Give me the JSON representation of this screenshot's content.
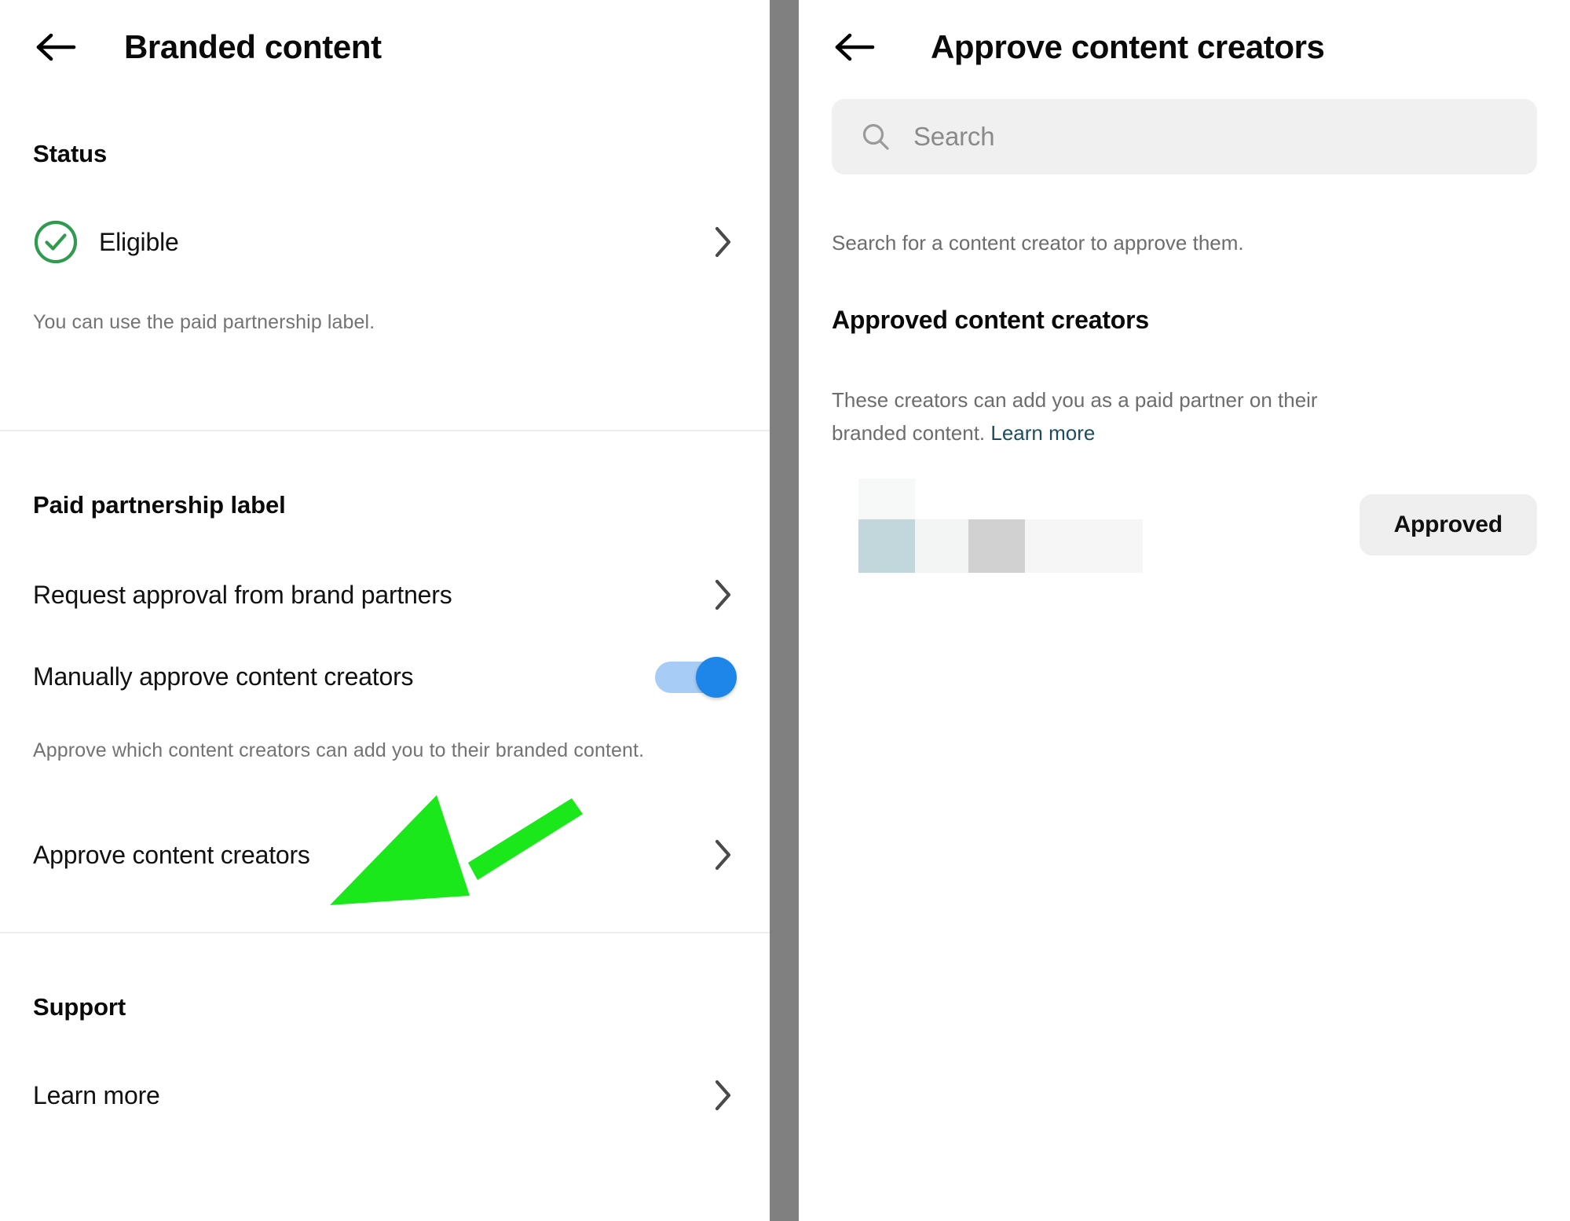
{
  "left": {
    "nav": {
      "back_icon": "back-arrow-icon",
      "title": "Branded content"
    },
    "status_section": {
      "heading": "Status",
      "status_icon": "check-circle-icon",
      "status_label": "Eligible",
      "chevron_icon": "chevron-right-icon",
      "helper": "You can use the paid partnership label."
    },
    "paid_partnership_section": {
      "heading": "Paid partnership label",
      "rows": [
        {
          "label": "Request approval from brand partners",
          "control": "chevron-right-icon"
        },
        {
          "label": "Manually approve content creators",
          "control": "toggle",
          "toggle_on": true
        },
        {
          "label": "Approve content creators",
          "control": "chevron-right-icon"
        }
      ],
      "helper": "Approve which content creators can add you to their branded content."
    },
    "support_section": {
      "heading": "Support",
      "rows": [
        {
          "label": "Learn more",
          "control": "chevron-right-icon"
        }
      ]
    },
    "annotation": {
      "name": "green-arrow-annotation",
      "color": "#1ae81a",
      "points_to": "Approve content creators"
    }
  },
  "right": {
    "nav": {
      "back_icon": "back-arrow-icon",
      "title": "Approve content creators"
    },
    "search": {
      "icon": "search-icon",
      "placeholder": "Search",
      "value": ""
    },
    "search_helper": "Search for a content creator to approve them.",
    "approved_section": {
      "heading": "Approved content creators",
      "description_prefix": "These creators can add you as a paid partner on their branded content. ",
      "learn_more_label": "Learn more",
      "creator_row": {
        "name": "redacted-creator-identity",
        "button_label": "Approved"
      }
    }
  },
  "colors": {
    "accent_blue": "#1d86e8",
    "toggle_track": "#a7cdf7",
    "status_green": "#2e9b4e",
    "annotation_green": "#1ae81a",
    "link_teal": "#1c4d5e",
    "divider_gray": "#808080",
    "chip_gray": "#efefef"
  }
}
